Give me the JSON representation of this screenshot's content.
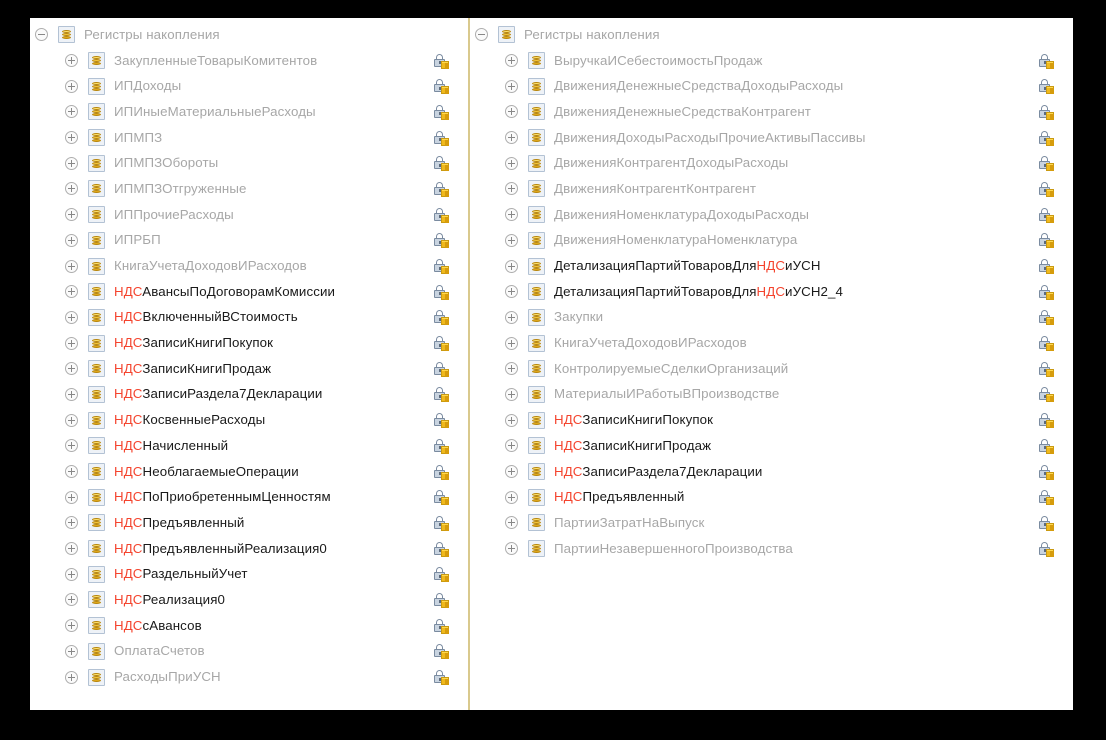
{
  "window": {
    "background_color": "#000000",
    "surface_color": "#ffffff",
    "divider_color": "#d9c98d"
  },
  "colors": {
    "highlight": "#f4442e",
    "normal_text": "#1a1a1a",
    "dimmed_text": "#a7a7a7",
    "icon_gold": "#f2c233",
    "icon_border": "#b3c2d4",
    "lock_blue": "#7a8ba0"
  },
  "icons": {
    "node": "accumulation-register-icon",
    "expand": "plus-circle-icon",
    "collapse": "minus-circle-icon",
    "lock": "lock-with-object-icon"
  },
  "panes": [
    {
      "id": "left",
      "root": {
        "label": "Регистры накопления",
        "state": "expanded",
        "style": "dim",
        "has_lock": false
      },
      "items": [
        {
          "label": "ЗакупленныеТоварыКомитентов",
          "style": "dim",
          "highlight": "",
          "has_lock": true
        },
        {
          "label": "ИПДоходы",
          "style": "dim",
          "highlight": "",
          "has_lock": true
        },
        {
          "label": "ИПИныеМатериальныеРасходы",
          "style": "dim",
          "highlight": "",
          "has_lock": true
        },
        {
          "label": "ИПМПЗ",
          "style": "dim",
          "highlight": "",
          "has_lock": true
        },
        {
          "label": "ИПМПЗОбороты",
          "style": "dim",
          "highlight": "",
          "has_lock": true
        },
        {
          "label": "ИПМПЗОтгруженные",
          "style": "dim",
          "highlight": "",
          "has_lock": true
        },
        {
          "label": "ИППрочиеРасходы",
          "style": "dim",
          "highlight": "",
          "has_lock": true
        },
        {
          "label": "ИПРБП",
          "style": "dim",
          "highlight": "",
          "has_lock": true
        },
        {
          "label": "КнигаУчетаДоходовИРасходов",
          "style": "dim",
          "highlight": "",
          "has_lock": true
        },
        {
          "label": "НДСАвансыПоДоговорамКомиссии",
          "style": "plain",
          "highlight": "НДС",
          "has_lock": true
        },
        {
          "label": "НДСВключенныйВСтоимость",
          "style": "plain",
          "highlight": "НДС",
          "has_lock": true
        },
        {
          "label": "НДСЗаписиКнигиПокупок",
          "style": "plain",
          "highlight": "НДС",
          "has_lock": true
        },
        {
          "label": "НДСЗаписиКнигиПродаж",
          "style": "plain",
          "highlight": "НДС",
          "has_lock": true
        },
        {
          "label": "НДСЗаписиРаздела7Декларации",
          "style": "plain",
          "highlight": "НДС",
          "has_lock": true
        },
        {
          "label": "НДСКосвенныеРасходы",
          "style": "plain",
          "highlight": "НДС",
          "has_lock": true
        },
        {
          "label": "НДСНачисленный",
          "style": "plain",
          "highlight": "НДС",
          "has_lock": true
        },
        {
          "label": "НДСНеоблагаемыеОперации",
          "style": "plain",
          "highlight": "НДС",
          "has_lock": true
        },
        {
          "label": "НДСПоПриобретеннымЦенностям",
          "style": "plain",
          "highlight": "НДС",
          "has_lock": true
        },
        {
          "label": "НДСПредъявленный",
          "style": "plain",
          "highlight": "НДС",
          "has_lock": true
        },
        {
          "label": "НДСПредъявленныйРеализация0",
          "style": "plain",
          "highlight": "НДС",
          "has_lock": true
        },
        {
          "label": "НДСРаздельныйУчет",
          "style": "plain",
          "highlight": "НДС",
          "has_lock": true
        },
        {
          "label": "НДСРеализация0",
          "style": "plain",
          "highlight": "НДС",
          "has_lock": true
        },
        {
          "label": "НДСсАвансов",
          "style": "plain",
          "highlight": "НДС",
          "has_lock": true
        },
        {
          "label": "ОплатаСчетов",
          "style": "dim",
          "highlight": "",
          "has_lock": true
        },
        {
          "label": "РасходыПриУСН",
          "style": "dim",
          "highlight": "",
          "has_lock": true
        }
      ]
    },
    {
      "id": "right",
      "root": {
        "label": "Регистры накопления",
        "state": "expanded",
        "style": "dim",
        "has_lock": false
      },
      "items": [
        {
          "label": "ВыручкаИСебестоимостьПродаж",
          "style": "dim",
          "highlight": "",
          "has_lock": true
        },
        {
          "label": "ДвиженияДенежныеСредстваДоходыРасходы",
          "style": "dim",
          "highlight": "",
          "has_lock": true
        },
        {
          "label": "ДвиженияДенежныеСредстваКонтрагент",
          "style": "dim",
          "highlight": "",
          "has_lock": true
        },
        {
          "label": "ДвиженияДоходыРасходыПрочиеАктивыПассивы",
          "style": "dim",
          "highlight": "",
          "has_lock": true
        },
        {
          "label": "ДвиженияКонтрагентДоходыРасходы",
          "style": "dim",
          "highlight": "",
          "has_lock": true
        },
        {
          "label": "ДвиженияКонтрагентКонтрагент",
          "style": "dim",
          "highlight": "",
          "has_lock": true
        },
        {
          "label": "ДвиженияНоменклатураДоходыРасходы",
          "style": "dim",
          "highlight": "",
          "has_lock": true
        },
        {
          "label": "ДвиженияНоменклатураНоменклатура",
          "style": "dim",
          "highlight": "",
          "has_lock": true
        },
        {
          "label": "ДетализацияПартийТоваровДляНДСиУСН",
          "style": "plain",
          "highlight": "НДС",
          "has_lock": true
        },
        {
          "label": "ДетализацияПартийТоваровДляНДСиУСН2_4",
          "style": "plain",
          "highlight": "НДС",
          "has_lock": true
        },
        {
          "label": "Закупки",
          "style": "dim",
          "highlight": "",
          "has_lock": true
        },
        {
          "label": "КнигаУчетаДоходовИРасходов",
          "style": "dim",
          "highlight": "",
          "has_lock": true
        },
        {
          "label": "КонтролируемыеСделкиОрганизаций",
          "style": "dim",
          "highlight": "",
          "has_lock": true
        },
        {
          "label": "МатериалыИРаботыВПроизводстве",
          "style": "dim",
          "highlight": "",
          "has_lock": true
        },
        {
          "label": "НДСЗаписиКнигиПокупок",
          "style": "plain",
          "highlight": "НДС",
          "has_lock": true
        },
        {
          "label": "НДСЗаписиКнигиПродаж",
          "style": "plain",
          "highlight": "НДС",
          "has_lock": true
        },
        {
          "label": "НДСЗаписиРаздела7Декларации",
          "style": "plain",
          "highlight": "НДС",
          "has_lock": true
        },
        {
          "label": "НДСПредъявленный",
          "style": "plain",
          "highlight": "НДС",
          "has_lock": true
        },
        {
          "label": "ПартииЗатратНаВыпуск",
          "style": "dim",
          "highlight": "",
          "has_lock": true
        },
        {
          "label": "ПартииНезавершенногоПроизводства",
          "style": "dim",
          "highlight": "",
          "has_lock": true
        }
      ]
    }
  ]
}
